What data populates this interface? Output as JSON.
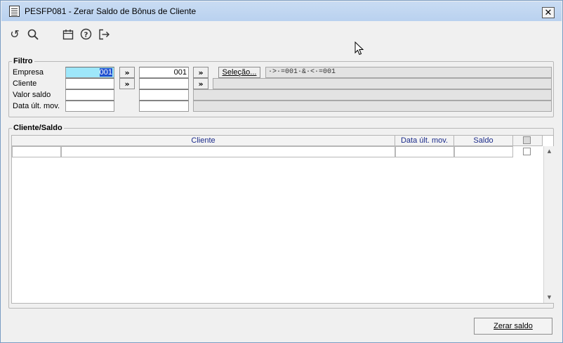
{
  "window": {
    "title": "PESFP081 - Zerar Saldo de Bônus de Cliente",
    "close_glyph": "✕"
  },
  "toolbar": {
    "icons": [
      "refresh-icon",
      "search-icon",
      "calendar-icon",
      "help-icon",
      "exit-icon"
    ]
  },
  "filtro": {
    "legend": "Filtro",
    "labels": {
      "empresa": "Empresa",
      "cliente": "Cliente",
      "valor_saldo": "Valor saldo",
      "data_ult_mov": "Data últ. mov."
    },
    "empresa_from": "001",
    "empresa_to": "001",
    "arrow_label": "»",
    "selecao_label": "Seleção...",
    "selection_expression": "·>·=001·&·<·=001"
  },
  "cliente_saldo": {
    "legend": "Cliente/Saldo",
    "columns": [
      "Cliente",
      "Data últ. mov.",
      "Saldo"
    ]
  },
  "actions": {
    "zerar_label": "Zerar saldo"
  }
}
